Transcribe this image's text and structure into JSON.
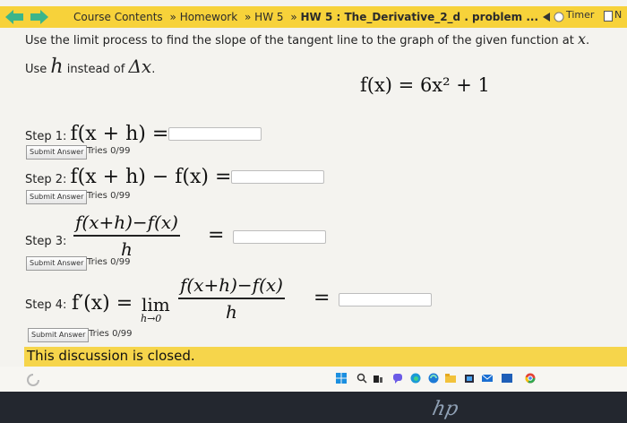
{
  "navbar": {
    "crumbs": [
      "Course Contents",
      "Homework",
      "HW 5",
      "HW 5 : The_Derivative_2_d . problem ..."
    ],
    "separator": "»",
    "timer_label": "Timer",
    "notes_label": "N"
  },
  "instruction": {
    "line1_prefix": "Use the limit process to find the slope of the tangent line to the graph of the given function at ",
    "line1_var": "x",
    "line1_suffix": ".",
    "line2_prefix": "Use ",
    "line2_var": "h",
    "line2_mid": " instead of ",
    "line2_delta": "Δx",
    "line2_suffix": "."
  },
  "function": "f(x) = 6x² + 1",
  "steps": [
    {
      "label": "Step 1:",
      "expr": "f(x + h) =",
      "submit": "Submit Answer",
      "tries": "Tries 0/99"
    },
    {
      "label": "Step 2:",
      "expr": "f(x + h) − f(x) =",
      "submit": "Submit Answer",
      "tries": "Tries 0/99"
    },
    {
      "label": "Step 3:",
      "numerator": "f(x+h)−f(x)",
      "denominator": "h",
      "equals": "=",
      "submit": "Submit Answer",
      "tries": "Tries 0/99"
    },
    {
      "label": "Step 4:",
      "lhs": "f′(x) = ",
      "lim": "lim",
      "lim_sub": "h→0",
      "numerator": "f(x+h)−f(x)",
      "denominator": "h",
      "equals": "=",
      "submit": "Submit Answer",
      "tries": "Tries 0/99"
    }
  ],
  "closed_message": "This discussion is closed.",
  "brand": "hp",
  "colors": {
    "navbar": "#f7d23a",
    "closed_bar": "#f6d54b",
    "nav_arrow": "#3bb58a"
  },
  "taskbar_icons": [
    "windows-icon",
    "search-icon",
    "task-view-icon",
    "chat-icon",
    "edge-icon",
    "file-explorer-icon",
    "store-icon",
    "mail-icon",
    "chrome-icon"
  ]
}
